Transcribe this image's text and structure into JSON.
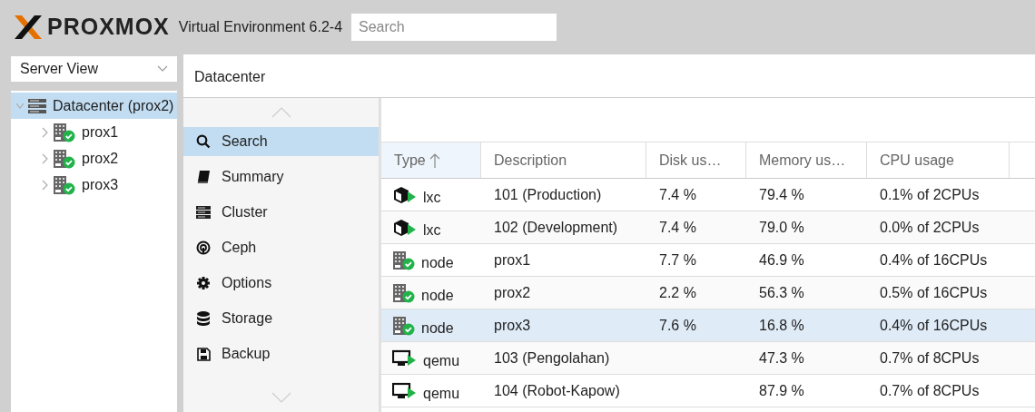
{
  "header": {
    "product": "PROXMOX",
    "version": "Virtual Environment 6.2-4",
    "search": {
      "placeholder": "Search"
    }
  },
  "view_selector": {
    "value": "Server View"
  },
  "tree": [
    {
      "label": "Datacenter (prox2)",
      "kind": "datacenter",
      "selected": true,
      "expanded": true,
      "children": [
        {
          "label": "prox1",
          "kind": "node",
          "selected": false,
          "expanded": false
        },
        {
          "label": "prox2",
          "kind": "node",
          "selected": false,
          "expanded": false
        },
        {
          "label": "prox3",
          "kind": "node",
          "selected": false,
          "expanded": false
        }
      ]
    }
  ],
  "panel": {
    "title": "Datacenter"
  },
  "nav": [
    {
      "label": "Search",
      "kind": "search",
      "selected": true
    },
    {
      "label": "Summary",
      "kind": "summary",
      "selected": false
    },
    {
      "label": "Cluster",
      "kind": "cluster",
      "selected": false
    },
    {
      "label": "Ceph",
      "kind": "ceph",
      "selected": false
    },
    {
      "label": "Options",
      "kind": "options",
      "selected": false
    },
    {
      "label": "Storage",
      "kind": "storage",
      "selected": false
    },
    {
      "label": "Backup",
      "kind": "backup",
      "selected": false
    }
  ],
  "table": {
    "columns": [
      {
        "label": "Type",
        "sorted": true
      },
      {
        "label": "Description",
        "sorted": false
      },
      {
        "label": "Disk us…",
        "sorted": false
      },
      {
        "label": "Memory us…",
        "sorted": false
      },
      {
        "label": "CPU usage",
        "sorted": false
      }
    ],
    "rows": [
      {
        "kind": "lxc",
        "type": "lxc",
        "description": "101 (Production)",
        "disk": "7.4 %",
        "memory": "79.4 %",
        "cpu": "0.1% of 2CPUs",
        "selected": false
      },
      {
        "kind": "lxc",
        "type": "lxc",
        "description": "102 (Development)",
        "disk": "7.4 %",
        "memory": "79.0 %",
        "cpu": "0.0% of 2CPUs",
        "selected": false
      },
      {
        "kind": "node",
        "type": "node",
        "description": "prox1",
        "disk": "7.7 %",
        "memory": "46.9 %",
        "cpu": "0.4% of 16CPUs",
        "selected": false
      },
      {
        "kind": "node",
        "type": "node",
        "description": "prox2",
        "disk": "2.2 %",
        "memory": "56.3 %",
        "cpu": "0.5% of 16CPUs",
        "selected": false
      },
      {
        "kind": "node",
        "type": "node",
        "description": "prox3",
        "disk": "7.6 %",
        "memory": "16.8 %",
        "cpu": "0.4% of 16CPUs",
        "selected": true
      },
      {
        "kind": "qemu",
        "type": "qemu",
        "description": "103 (Pengolahan)",
        "memory": "47.3 %",
        "cpu": "0.7% of 8CPUs",
        "selected": false
      },
      {
        "kind": "qemu",
        "type": "qemu",
        "description": "104 (Robot-Kapow)",
        "memory": "87.9 %",
        "cpu": "0.7% of 8CPUs",
        "selected": false
      }
    ]
  }
}
